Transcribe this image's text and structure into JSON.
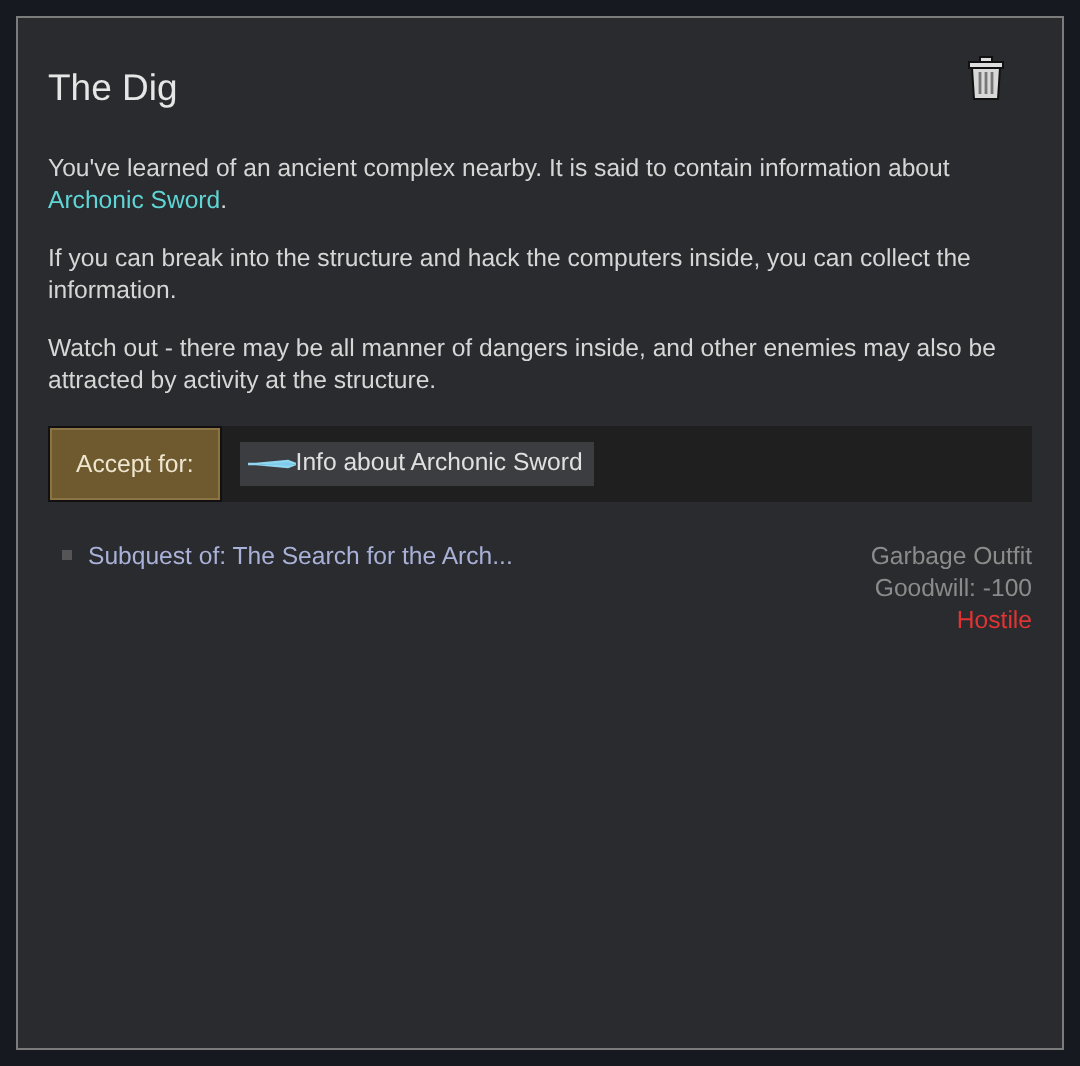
{
  "quest": {
    "title": "The Dig",
    "intro": {
      "before": "You've learned of an ancient complex nearby. It is said to contain information about ",
      "link": "Archonic Sword",
      "after": "."
    },
    "paragraphs": [
      "If you can break into the structure and hack the computers inside, you can collect the information.",
      "Watch out - there may be all manner of dangers inside, and other enemies may also be attracted by activity at the structure."
    ],
    "accept_button": "Accept for:",
    "reward": "Info about Archonic Sword",
    "parent": "Subquest of: The Search for the Arch...",
    "faction": {
      "name": "Garbage Outfit",
      "goodwill": "Goodwill: -100",
      "standing": "Hostile",
      "hostile": true
    }
  }
}
